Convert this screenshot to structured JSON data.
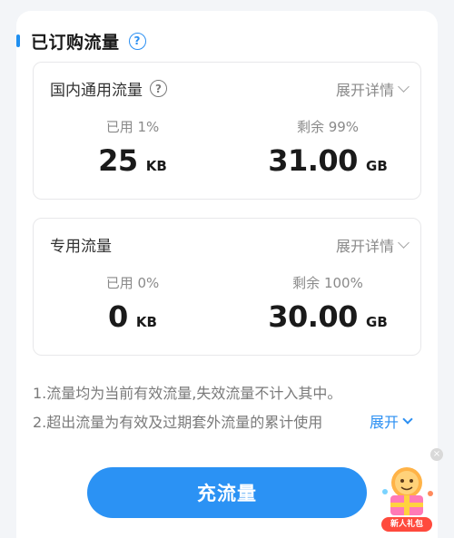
{
  "header": {
    "title": "已订购流量",
    "help_glyph": "?"
  },
  "cards": [
    {
      "title": "国内通用流量",
      "help_glyph": "?",
      "expand_label": "展开详情",
      "used_label": "已用 1%",
      "used_value": "25",
      "used_unit": "KB",
      "remaining_label": "剩余 99%",
      "remaining_value": "31.00",
      "remaining_unit": "GB"
    },
    {
      "title": "专用流量",
      "expand_label": "展开详情",
      "used_label": "已用 0%",
      "used_value": "0",
      "used_unit": "KB",
      "remaining_label": "剩余 100%",
      "remaining_value": "30.00",
      "remaining_unit": "GB"
    }
  ],
  "notes": {
    "line1": "1.流量均为当前有效流量,失效流量不计入其中。",
    "line2": "2.超出流量为有效及过期套外流量的累计使用",
    "expand_label": "展开"
  },
  "recharge_button": {
    "label": "充流量"
  },
  "gift": {
    "badge": "新人礼包",
    "close_glyph": "×"
  },
  "colors": {
    "accent": "#2b92f4",
    "badge": "#ff4a3d"
  }
}
